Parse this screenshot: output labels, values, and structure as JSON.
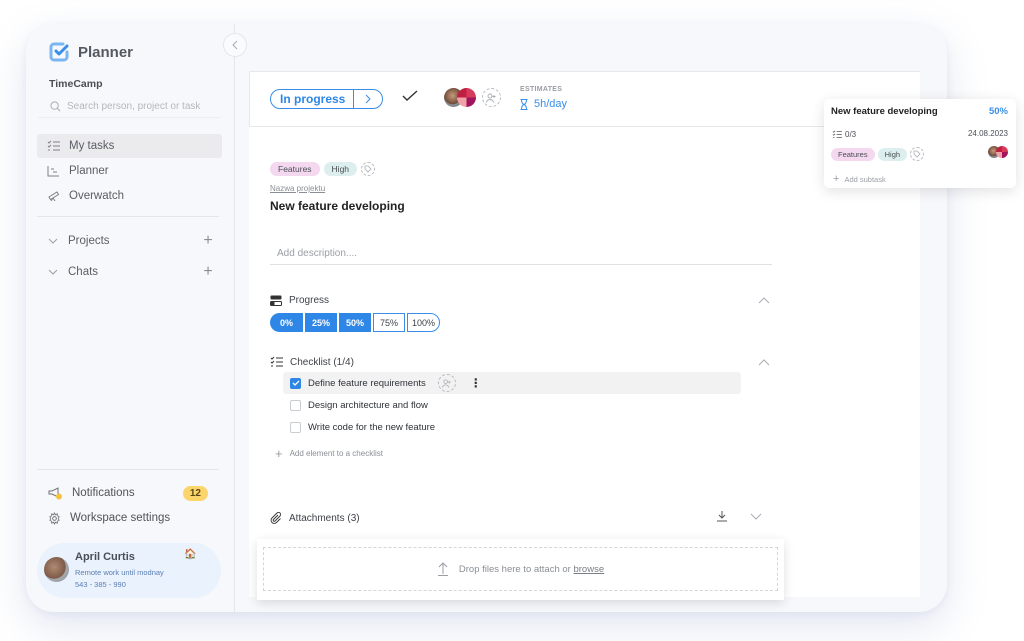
{
  "app": {
    "name": "Planner",
    "workspace": "TimeCamp",
    "brand_color": "#2e86e6"
  },
  "sidebar": {
    "search_placeholder": "Search person, project or task",
    "nav": [
      {
        "label": "My tasks",
        "icon": "tasks-list-icon",
        "active": true
      },
      {
        "label": "Planner",
        "icon": "planner-chart-icon",
        "active": false
      },
      {
        "label": "Overwatch",
        "icon": "telescope-icon",
        "active": false
      }
    ],
    "groups": [
      {
        "label": "Projects"
      },
      {
        "label": "Chats"
      }
    ],
    "notifications": {
      "label": "Notifications",
      "count": "12"
    },
    "settings_label": "Workspace settings",
    "user": {
      "name": "April Curtis",
      "status": "Remote work until modnay",
      "phone": "543 - 385 - 990",
      "status_emoji": "🏠"
    }
  },
  "task": {
    "status": "In progress",
    "estimates_label": "ESTIMATES",
    "estimates_value": "5h/day",
    "tags": [
      {
        "label": "Features",
        "color": "#f3d8ef"
      },
      {
        "label": "High",
        "color": "#dceeee"
      }
    ],
    "project_link": "Nazwa projektu",
    "title": "New feature developing",
    "description_placeholder": "Add description....",
    "progress": {
      "label": "Progress",
      "options": [
        "0%",
        "25%",
        "50%",
        "75%",
        "100%"
      ],
      "value_percent": 50
    },
    "checklist": {
      "label": "Checklist (1/4)",
      "items": [
        {
          "text": "Define feature requirements",
          "checked": true
        },
        {
          "text": "Design architecture and flow",
          "checked": false
        },
        {
          "text": "Write code for the new feature",
          "checked": false
        }
      ],
      "add_label": "Add element to a checklist"
    },
    "attachments": {
      "label": "Attachments (3)",
      "drop_text": "Drop files here to attach or",
      "browse_label": "browse"
    }
  },
  "floating_card": {
    "title": "New feature developing",
    "percent": "50%",
    "subtasks": "0/3",
    "date": "24.08.2023",
    "tags": [
      "Features",
      "High"
    ],
    "add_subtask": "Add subtask"
  }
}
